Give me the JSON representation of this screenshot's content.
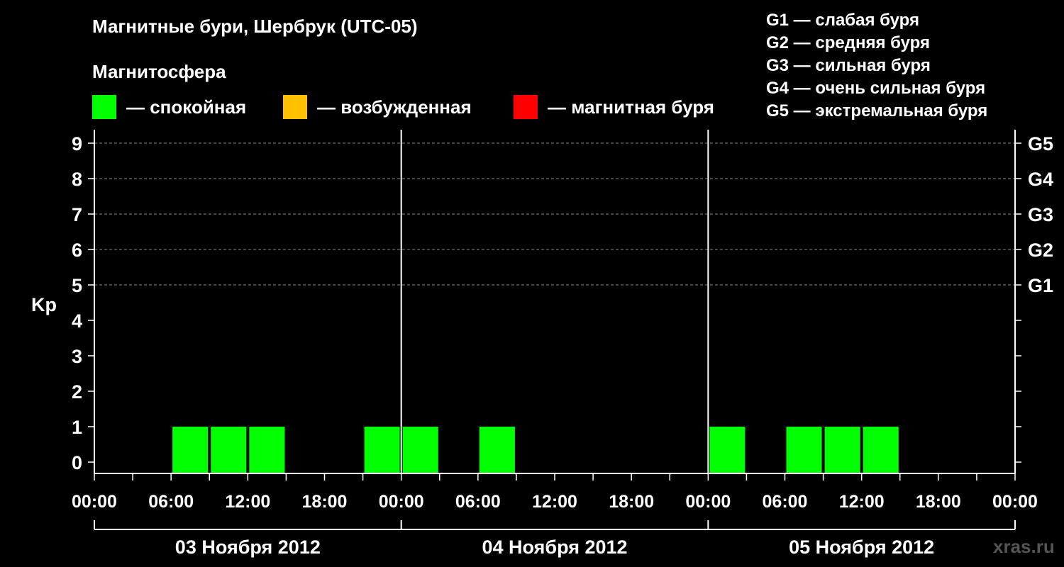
{
  "header": {
    "title": "Магнитные бури, Шербрук (UTC-05)",
    "subtitle": "Магнитосфера"
  },
  "legend": [
    {
      "label": "— спокойная",
      "color": "#00ff00"
    },
    {
      "label": "— возбужденная",
      "color": "#ffc000"
    },
    {
      "label": "— магнитная буря",
      "color": "#ff0000"
    }
  ],
  "storm_levels": [
    "G1 — слабая буря",
    "G2 — средняя буря",
    "G3 — сильная буря",
    "G4 — очень сильная буря",
    "G5 — экстремальная буря"
  ],
  "watermark": "xras.ru",
  "chart_data": {
    "type": "bar",
    "ylabel": "Kp",
    "ylim": [
      0,
      9
    ],
    "yticks": [
      "0",
      "1",
      "2",
      "3",
      "4",
      "5",
      "6",
      "7",
      "8",
      "9"
    ],
    "right_ticks": [
      {
        "kp": 5,
        "label": "G1"
      },
      {
        "kp": 6,
        "label": "G2"
      },
      {
        "kp": 7,
        "label": "G3"
      },
      {
        "kp": 8,
        "label": "G4"
      },
      {
        "kp": 9,
        "label": "G5"
      }
    ],
    "grid": "horizontal dashed at Kp 5-9",
    "xtick_labels": [
      "00:00",
      "06:00",
      "12:00",
      "18:00",
      "00:00",
      "06:00",
      "12:00",
      "18:00",
      "00:00",
      "06:00",
      "12:00",
      "18:00",
      "00:00"
    ],
    "days": [
      "03 Ноября 2012",
      "04 Ноября 2012",
      "05 Ноября 2012"
    ],
    "interval_hours": 3,
    "bars": [
      {
        "day": 0,
        "start": "00:00",
        "kp": 0
      },
      {
        "day": 0,
        "start": "03:00",
        "kp": 0
      },
      {
        "day": 0,
        "start": "06:00",
        "kp": 1
      },
      {
        "day": 0,
        "start": "09:00",
        "kp": 1
      },
      {
        "day": 0,
        "start": "12:00",
        "kp": 1
      },
      {
        "day": 0,
        "start": "15:00",
        "kp": 0
      },
      {
        "day": 0,
        "start": "18:00",
        "kp": 0
      },
      {
        "day": 0,
        "start": "21:00",
        "kp": 1
      },
      {
        "day": 1,
        "start": "00:00",
        "kp": 1
      },
      {
        "day": 1,
        "start": "03:00",
        "kp": 0
      },
      {
        "day": 1,
        "start": "06:00",
        "kp": 1
      },
      {
        "day": 1,
        "start": "09:00",
        "kp": 0
      },
      {
        "day": 1,
        "start": "12:00",
        "kp": 0
      },
      {
        "day": 1,
        "start": "15:00",
        "kp": 0
      },
      {
        "day": 1,
        "start": "18:00",
        "kp": 0
      },
      {
        "day": 1,
        "start": "21:00",
        "kp": 0
      },
      {
        "day": 2,
        "start": "00:00",
        "kp": 1
      },
      {
        "day": 2,
        "start": "03:00",
        "kp": 0
      },
      {
        "day": 2,
        "start": "06:00",
        "kp": 1
      },
      {
        "day": 2,
        "start": "09:00",
        "kp": 1
      },
      {
        "day": 2,
        "start": "12:00",
        "kp": 1
      },
      {
        "day": 2,
        "start": "15:00",
        "kp": 0
      },
      {
        "day": 2,
        "start": "18:00",
        "kp": 0
      },
      {
        "day": 2,
        "start": "21:00",
        "kp": 0
      }
    ],
    "bar_color": "#00ff00"
  }
}
